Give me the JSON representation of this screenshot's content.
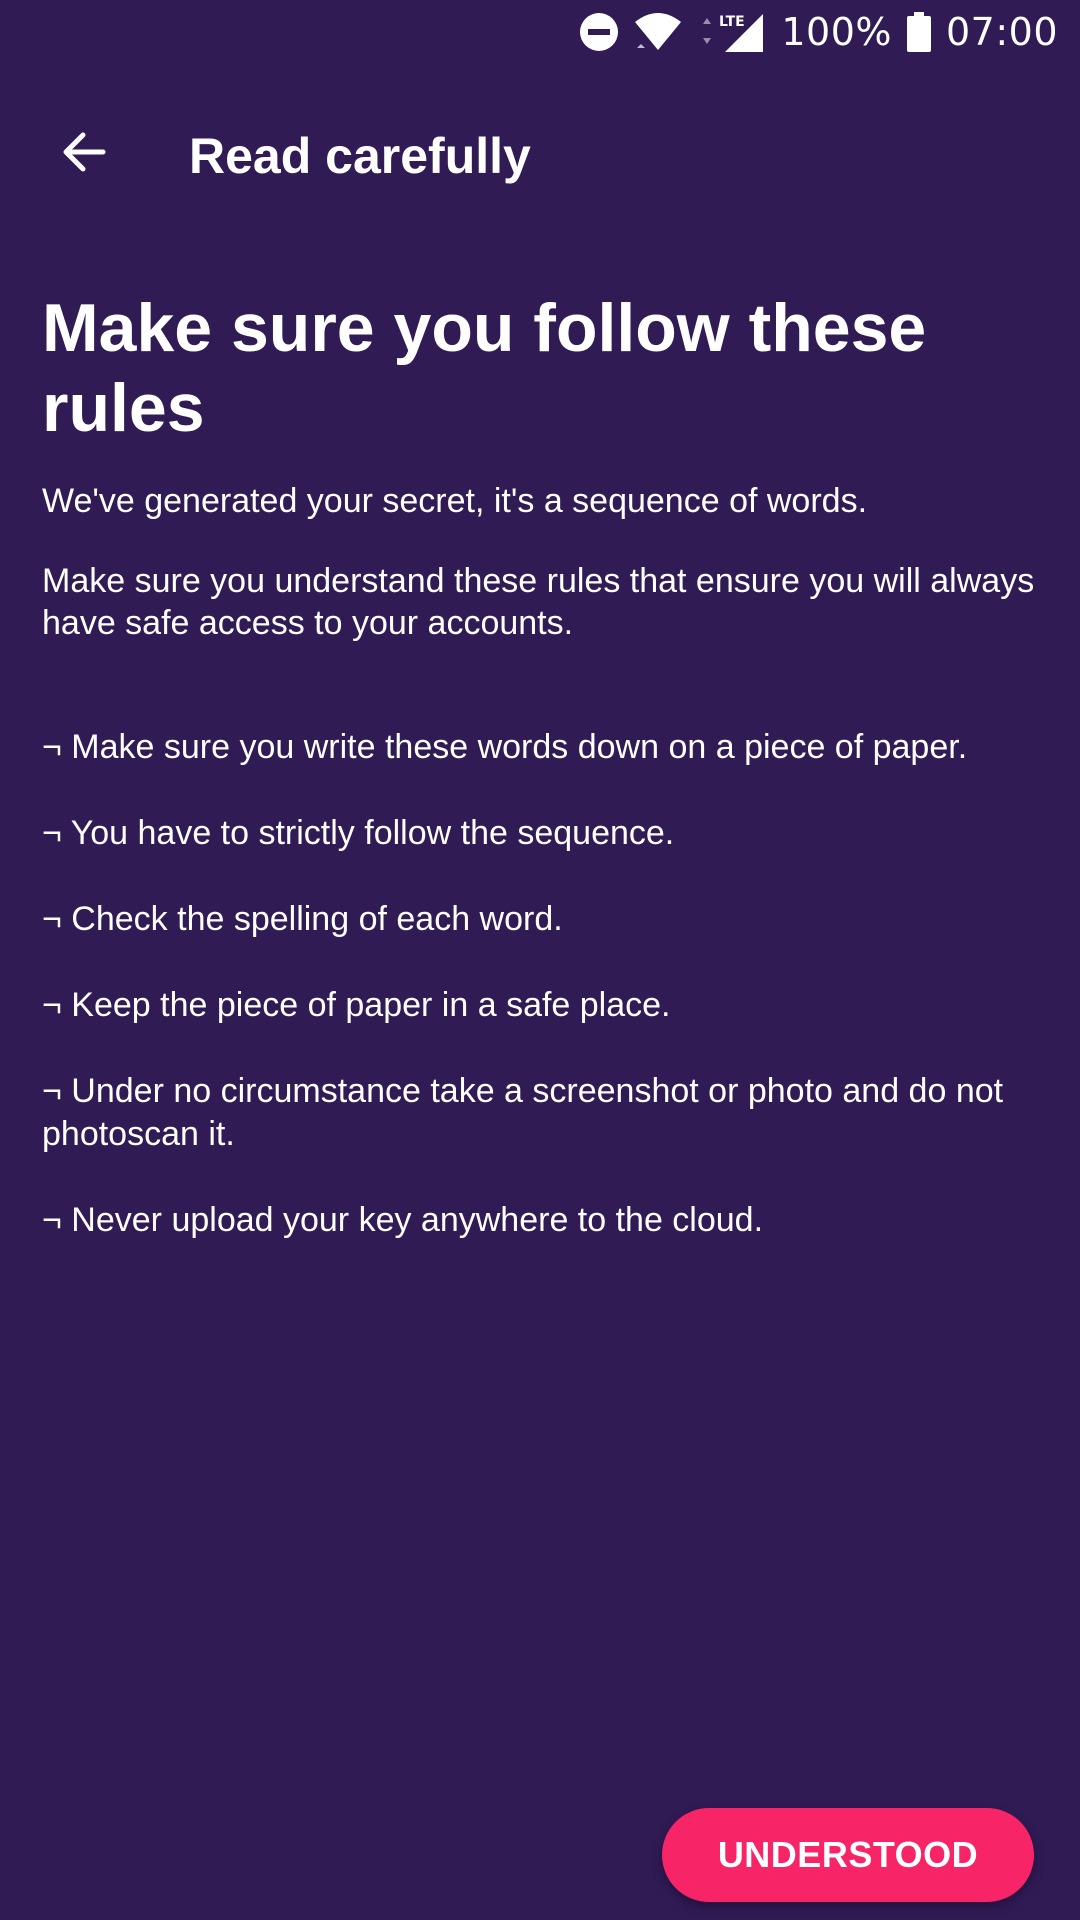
{
  "status_bar": {
    "icons": [
      "do-not-disturb-icon",
      "wifi-icon",
      "lte-signal-icon",
      "battery-icon"
    ],
    "network_type": "LTE",
    "battery_percent": "100%",
    "time": "07:00"
  },
  "toolbar": {
    "back_icon": "arrow-back-icon",
    "title": "Read carefully"
  },
  "content": {
    "headline": "Make sure you follow these rules",
    "intro": [
      "We've generated your secret, it's a sequence of words.",
      "Make sure you understand these rules that ensure you will always have safe access to your accounts."
    ],
    "rules": [
      "¬ Make sure you write these words down on a piece of paper.",
      "¬ You have to strictly follow the sequence.",
      "¬ Check the spelling of each word.",
      "¬ Keep the piece of paper in a safe place.",
      "¬ Under no circumstance take a screenshot or photo and do not photoscan it.",
      "¬ Never upload your key anywhere to the cloud."
    ]
  },
  "actions": {
    "understood_label": "UNDERSTOOD"
  },
  "colors": {
    "background": "#301b55",
    "text": "#ffffff",
    "accent": "#f72468"
  }
}
